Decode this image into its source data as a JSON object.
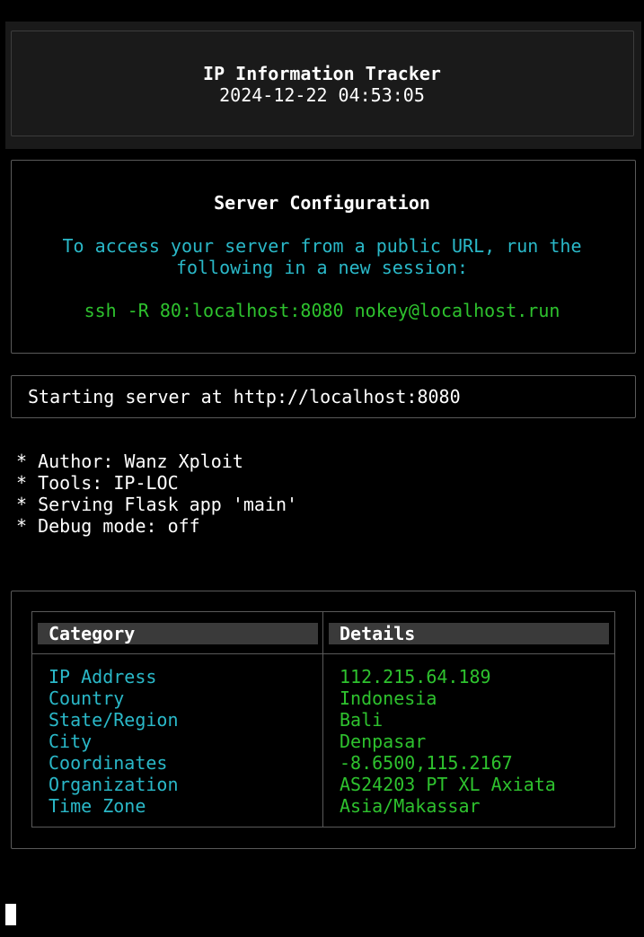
{
  "header": {
    "title": "IP Information Tracker",
    "timestamp": "2024-12-22 04:53:05"
  },
  "config": {
    "title": "Server Configuration",
    "instruction_line1": "To access your server from a public URL, run the",
    "instruction_line2": "following in a new session:",
    "command": "ssh -R 80:localhost:8080 nokey@localhost.run"
  },
  "server": {
    "status": "Starting server at http://localhost:8080"
  },
  "info_lines": [
    "* Author: Wanz Xploit",
    "* Tools: IP-LOC",
    "* Serving Flask app 'main'",
    "* Debug mode: off"
  ],
  "table": {
    "headers": [
      "Category",
      "Details"
    ],
    "rows": [
      {
        "category": "IP Address",
        "details": "112.215.64.189"
      },
      {
        "category": "Country",
        "details": "Indonesia"
      },
      {
        "category": "State/Region",
        "details": "Bali"
      },
      {
        "category": "City",
        "details": "Denpasar"
      },
      {
        "category": "Coordinates",
        "details": "-8.6500,115.2167"
      },
      {
        "category": "Organization",
        "details": "AS24203 PT XL Axiata"
      },
      {
        "category": "Time Zone",
        "details": "Asia/Makassar"
      }
    ]
  },
  "colors": {
    "background": "#000000",
    "cyan": "#2ab8c8",
    "green": "#2ec22e",
    "header_bar": "#1a1a1a"
  }
}
